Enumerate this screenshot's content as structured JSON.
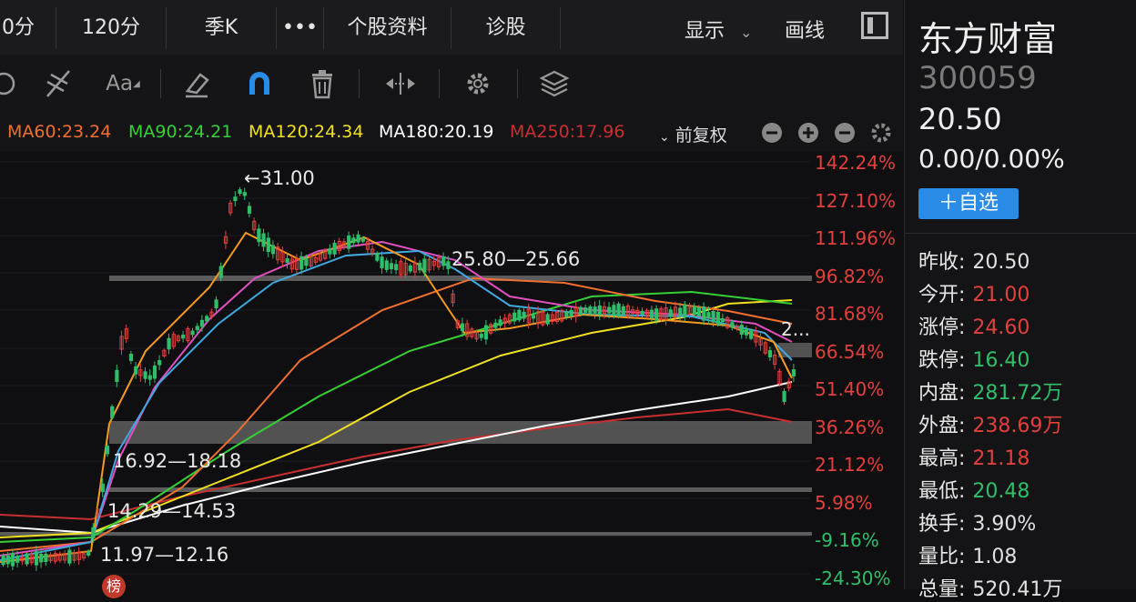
{
  "tabs": [
    "0分",
    "120分",
    "季K",
    "•••",
    "个股资料",
    "诊股"
  ],
  "tabbar_right": {
    "display_label": "显示",
    "draw_label": "画线"
  },
  "ma_legend": [
    {
      "label": "MA60:23.24",
      "color": "#f07030"
    },
    {
      "label": "MA90:24.21",
      "color": "#35d035"
    },
    {
      "label": "MA120:24.34",
      "color": "#f0e020"
    },
    {
      "label": "MA180:20.19",
      "color": "#ffffff"
    },
    {
      "label": "MA250:17.96",
      "color": "#c83030"
    }
  ],
  "adjust_label": "前复权",
  "right_axis": [
    "142.24%",
    "127.10%",
    "111.96%",
    "96.82%",
    "81.68%",
    "66.54%",
    "51.40%",
    "36.26%",
    "21.12%",
    "5.98%",
    "-9.16%",
    "-24.30%"
  ],
  "annotations": {
    "peak": "←31.00",
    "band1": "25.80—25.66",
    "band2": "16.92—18.18",
    "band3": "14.29—14.53",
    "band4": "11.97—12.16",
    "cut": "2...",
    "marker": "榜"
  },
  "stock": {
    "name": "东方财富",
    "code": "300059",
    "price": "20.50",
    "change": "0.00/0.00%",
    "watch_button": "＋自选"
  },
  "quote_rows": [
    {
      "k": "昨收:",
      "v": "20.50",
      "color": "#e0e0e0"
    },
    {
      "k": "今开:",
      "v": "21.00",
      "color": "#e2403c"
    },
    {
      "k": "涨停:",
      "v": "24.60",
      "color": "#e2403c"
    },
    {
      "k": "跌停:",
      "v": "16.40",
      "color": "#2fbf6a"
    },
    {
      "k": "内盘:",
      "v": "281.72万",
      "color": "#2fbf6a"
    },
    {
      "k": "外盘:",
      "v": "238.69万",
      "color": "#e2403c"
    },
    {
      "k": "最高:",
      "v": "21.18",
      "color": "#e2403c"
    },
    {
      "k": "最低:",
      "v": "20.48",
      "color": "#2fbf6a"
    },
    {
      "k": "换手:",
      "v": "3.90%",
      "color": "#e0e0e0"
    },
    {
      "k": "量比:",
      "v": "1.08",
      "color": "#e0e0e0"
    },
    {
      "k": "总量:",
      "v": "520.41万",
      "color": "#e0e0e0"
    }
  ],
  "colors": {
    "up": "#e2403c",
    "down": "#2fbf6a",
    "accent": "#2b8ce8"
  }
}
